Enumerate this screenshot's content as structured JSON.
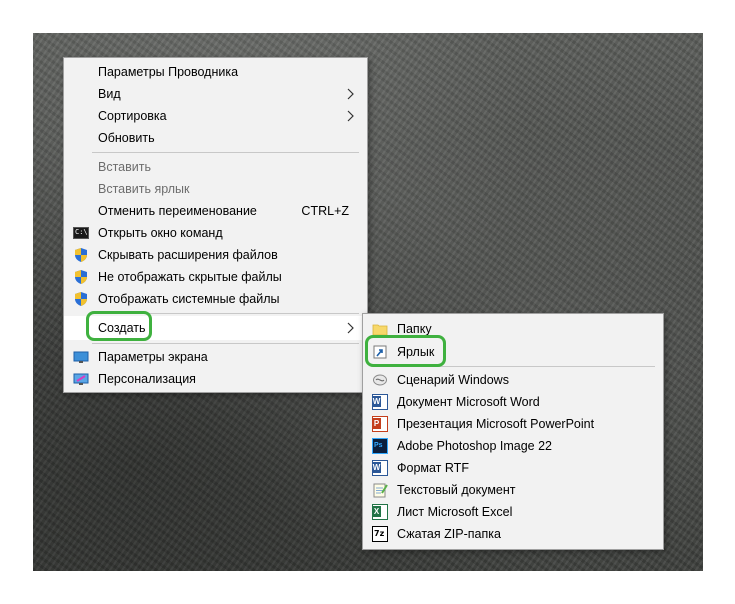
{
  "context_menu": {
    "items": [
      {
        "label": "Параметры Проводника"
      },
      {
        "label": "Вид"
      },
      {
        "label": "Сортировка"
      },
      {
        "label": "Обновить"
      },
      {
        "label": "Вставить"
      },
      {
        "label": "Вставить ярлык"
      },
      {
        "label": "Отменить переименование",
        "shortcut": "CTRL+Z"
      },
      {
        "label": "Открыть окно команд"
      },
      {
        "label": "Скрывать расширения файлов"
      },
      {
        "label": "Не отображать скрытые файлы"
      },
      {
        "label": "Отображать системные файлы"
      },
      {
        "label": "Создать"
      },
      {
        "label": "Параметры экрана"
      },
      {
        "label": "Персонализация"
      }
    ]
  },
  "create_submenu": {
    "items": [
      {
        "label": "Папку"
      },
      {
        "label": "Ярлык"
      },
      {
        "label": "Сценарий Windows"
      },
      {
        "label": "Документ Microsoft Word"
      },
      {
        "label": "Презентация Microsoft PowerPoint"
      },
      {
        "label": "Adobe Photoshop Image 22"
      },
      {
        "label": "Формат RTF"
      },
      {
        "label": "Текстовый документ"
      },
      {
        "label": "Лист Microsoft Excel"
      },
      {
        "label": "Сжатая ZIP-папка"
      }
    ]
  },
  "icons": {
    "cmd_text": "C:\\",
    "ps_text": "Ps",
    "word_text": "W",
    "excel_text": "X",
    "ppt_text": "P",
    "zip_text": "7z"
  },
  "colors": {
    "highlight": "#3fb13f",
    "menu_bg": "#f2f2f2",
    "disabled_text": "#6d6d6d"
  }
}
